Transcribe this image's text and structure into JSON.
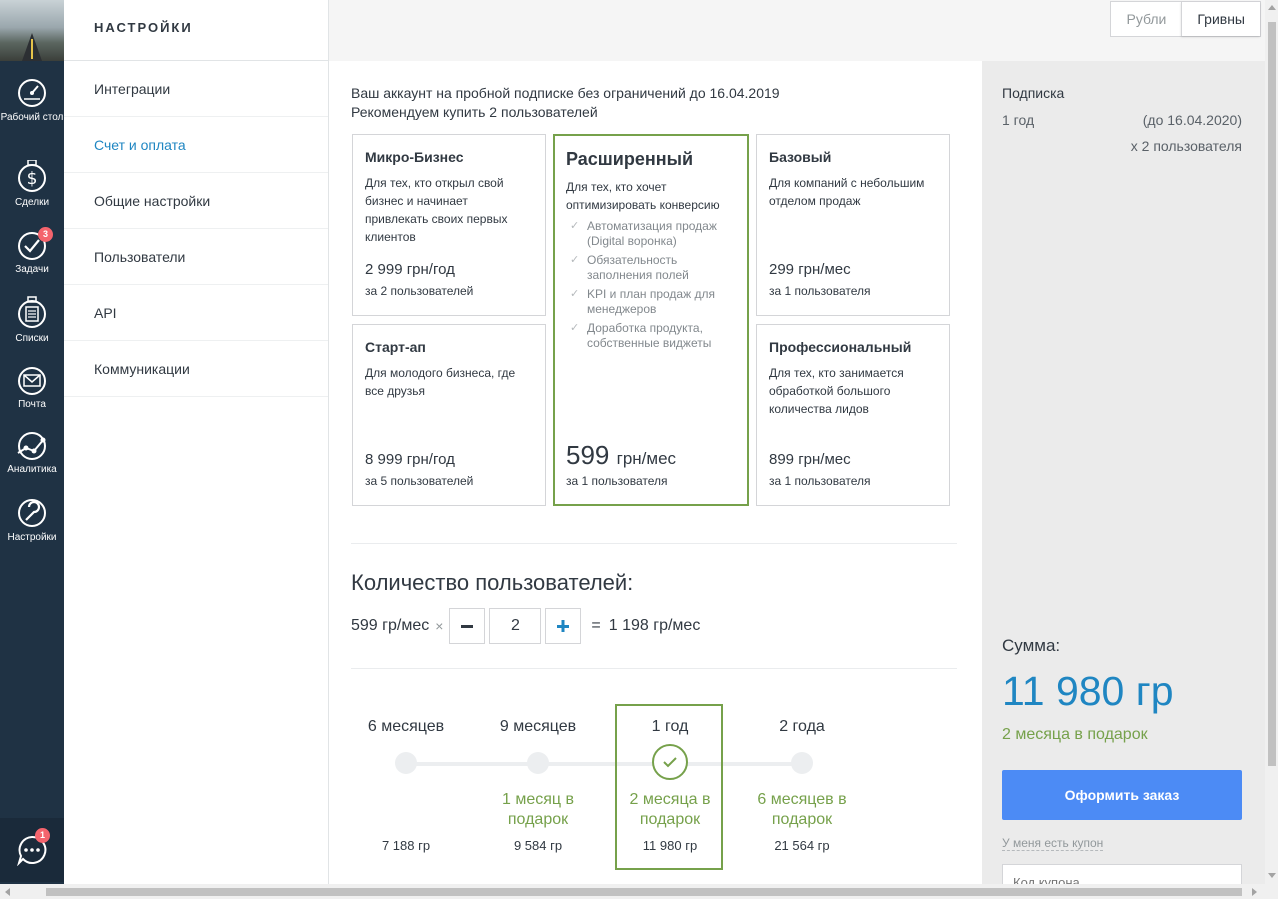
{
  "leftnav": {
    "items": [
      {
        "label": "Рабочий стол",
        "icon": "dashboard-icon"
      },
      {
        "label": "Сделки",
        "icon": "dollar-icon"
      },
      {
        "label": "Задачи",
        "icon": "check-circle-icon",
        "badge": "3"
      },
      {
        "label": "Списки",
        "icon": "list-icon"
      },
      {
        "label": "Почта",
        "icon": "mail-icon"
      },
      {
        "label": "Аналитика",
        "icon": "analytics-icon"
      },
      {
        "label": "Настройки",
        "icon": "wrench-icon"
      }
    ],
    "chat_badge": "1"
  },
  "submenu": {
    "title": "НАСТРОЙКИ",
    "items": [
      {
        "label": "Интеграции"
      },
      {
        "label": "Счет и оплата",
        "active": true
      },
      {
        "label": "Общие настройки"
      },
      {
        "label": "Пользователи"
      },
      {
        "label": "API"
      },
      {
        "label": "Коммуникации"
      }
    ]
  },
  "currency": {
    "options": [
      "Рубли",
      "Гривны"
    ],
    "selected": "Гривны"
  },
  "trial": {
    "line1": "Ваш аккаунт на пробной подписке без ограничений до 16.04.2019",
    "line2": "Рекомендуем купить 2 пользователей"
  },
  "plans": {
    "micro": {
      "name": "Микро-Бизнес",
      "desc": "Для тех, кто открыл свой бизнес и начинает привлекать своих первых клиентов",
      "price": "2 999 грн/год",
      "users": "за 2 пользователей"
    },
    "startup": {
      "name": "Старт-ап",
      "desc": "Для молодого бизнеса, где все друзья",
      "price": "8 999 грн/год",
      "users": "за 5 пользователей"
    },
    "extended": {
      "name": "Расширенный",
      "desc": "Для тех, кто хочет оптимизировать конверсию",
      "features": [
        "Автоматизация продаж (Digital воронка)",
        "Обязательность заполнения полей",
        "KPI и план продаж для менеджеров",
        "Доработка продукта, собственные виджеты"
      ],
      "price_value": "599",
      "price_unit": "грн/мес",
      "users": "за 1 пользователя"
    },
    "basic": {
      "name": "Базовый",
      "desc": "Для компаний с небольшим отделом продаж",
      "price": "299 грн/мес",
      "users": "за 1 пользователя"
    },
    "pro": {
      "name": "Профессиональный",
      "desc": "Для тех, кто занимается обработкой большого количества лидов",
      "price": "899 грн/мес",
      "users": "за 1 пользователя"
    }
  },
  "user_count": {
    "title": "Количество пользователей:",
    "unit_price": "599 гр/мес",
    "times": "×",
    "quantity": "2",
    "equals": "=",
    "result": "1 198 гр/мес"
  },
  "periods": [
    {
      "label": "6 месяцев",
      "gift": "",
      "sum": "7 188 гр"
    },
    {
      "label": "9 месяцев",
      "gift": "1 месяц в подарок",
      "sum": "9 584 гр"
    },
    {
      "label": "1 год",
      "gift": "2 месяца в подарок",
      "sum": "11 980 гр",
      "selected": true
    },
    {
      "label": "2 года",
      "gift": "6 месяцев в подарок",
      "sum": "21 564 гр"
    }
  ],
  "summary": {
    "label": "Подписка",
    "period": "1 год",
    "until": "(до 16.04.2020)",
    "users": "x 2 пользователя",
    "total_label": "Сумма:",
    "total_value": "11 980 гр",
    "gift": "2 месяца в подарок",
    "order_button": "Оформить заказ",
    "coupon_link": "У меня есть купон",
    "coupon_placeholder": "Код купона"
  },
  "colors": {
    "nav_bg": "#1f3244",
    "accent_green": "#76a14b",
    "accent_blue": "#1f86c2",
    "button_blue": "#4c8bf5",
    "badge_red": "#f4646d"
  }
}
